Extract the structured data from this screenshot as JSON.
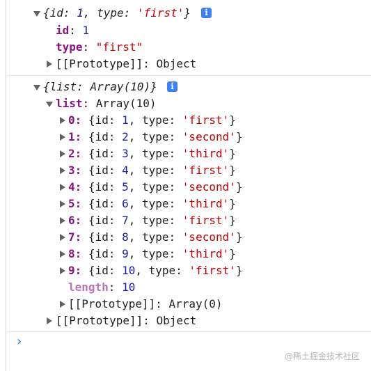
{
  "object1": {
    "summary": {
      "open": "{",
      "k1": "id:",
      "v1": "1",
      "sep": ",",
      "k2": "type:",
      "v2": "'first'",
      "close": "}"
    },
    "info_glyph": "i",
    "props": [
      {
        "key": "id",
        "value": "1"
      },
      {
        "key": "type",
        "value": "\"first\""
      }
    ],
    "prototype": {
      "label": "[[Prototype]]",
      "value": "Object"
    }
  },
  "object2": {
    "summary": {
      "open": "{",
      "k1": "list:",
      "v1": "Array(10)",
      "close": "}"
    },
    "info_glyph": "i",
    "list": {
      "key": "list",
      "value": "Array(10)",
      "items": [
        {
          "index": "0",
          "id": "1",
          "type": "'first'"
        },
        {
          "index": "1",
          "id": "2",
          "type": "'second'"
        },
        {
          "index": "2",
          "id": "3",
          "type": "'third'"
        },
        {
          "index": "3",
          "id": "4",
          "type": "'first'"
        },
        {
          "index": "4",
          "id": "5",
          "type": "'second'"
        },
        {
          "index": "5",
          "id": "6",
          "type": "'third'"
        },
        {
          "index": "6",
          "id": "7",
          "type": "'first'"
        },
        {
          "index": "7",
          "id": "8",
          "type": "'second'"
        },
        {
          "index": "8",
          "id": "9",
          "type": "'third'"
        },
        {
          "index": "9",
          "id": "10",
          "type": "'first'"
        }
      ],
      "length": {
        "key": "length",
        "value": "10"
      },
      "prototype": {
        "label": "[[Prototype]]",
        "value": "Array(0)"
      }
    },
    "prototype": {
      "label": "[[Prototype]]",
      "value": "Object"
    }
  },
  "console": {
    "prompt_glyph": "›"
  },
  "watermark": "@稀土掘金技术社区",
  "colors": {
    "key": "#881280",
    "number": "#1a1aa6",
    "string": "#c80000",
    "info_badge": "#3b82f6",
    "prompt": "#1a73e8"
  }
}
